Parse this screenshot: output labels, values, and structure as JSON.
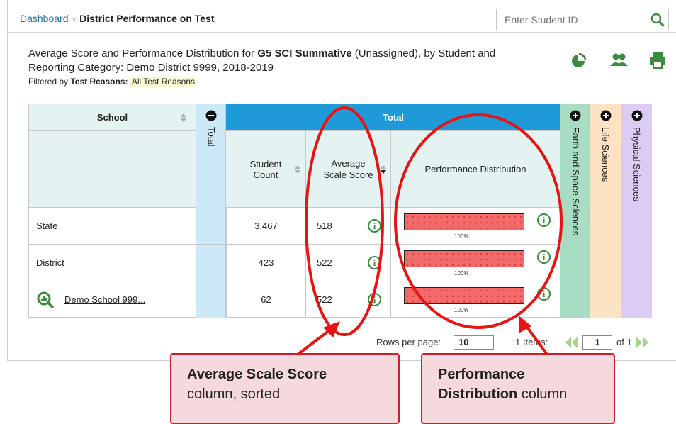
{
  "breadcrumb": {
    "home": "Dashboard",
    "separator": "›",
    "current": "District Performance on Test"
  },
  "search": {
    "placeholder": "Enter Student ID",
    "icon": "search-icon"
  },
  "heading": {
    "prefix": "Average Score and Performance Distribution for ",
    "assessment": "G5 SCI Summative",
    "middle": " (Unassigned), by Student and",
    "line2": "Reporting Category: Demo District 9999, 2018-2019"
  },
  "filter": {
    "label": "Filtered by ",
    "key": "Test Reasons:",
    "value": "All Test Reasons"
  },
  "toolbar_icons": [
    "pie-chart-icon",
    "group-students-icon",
    "print-icon"
  ],
  "table": {
    "school_header": "School",
    "total_collapse_label": "Total",
    "total_header": "Total",
    "col_student_count": "Student Count",
    "col_avg_line1": "Average",
    "col_avg_line2": "Scale Score",
    "col_perf": "Performance Distribution",
    "categories": [
      "Earth and Space Sciences",
      "Life Sciences",
      "Physical Sciences"
    ],
    "category_colors": [
      "#a8ddc4",
      "#fde2c4",
      "#dccbf3"
    ],
    "rows": [
      {
        "name": "State",
        "count": "3,467",
        "avg": "518",
        "pct": "100%",
        "distribution": 1.0
      },
      {
        "name": "District",
        "count": "423",
        "avg": "522",
        "pct": "100%",
        "distribution": 1.0
      },
      {
        "name": "Demo School 999...",
        "count": "62",
        "avg": "522",
        "pct": "100%",
        "distribution": 1.0,
        "link": true
      }
    ]
  },
  "pager": {
    "rows_label": "Rows per page:",
    "rows_value": "10",
    "items_label": "1 Items:",
    "page": "1",
    "of": "of 1"
  },
  "callouts": [
    {
      "bold": "Average Scale Score",
      "text": "column, sorted"
    },
    {
      "bold_line1": "Performance",
      "bold_line2": "Distribution",
      "text": " column"
    }
  ],
  "colors": {
    "accent": "#1e9ad8",
    "annotation": "#e81414",
    "success": "#3a8d3a",
    "bar": "#f26a6a"
  }
}
